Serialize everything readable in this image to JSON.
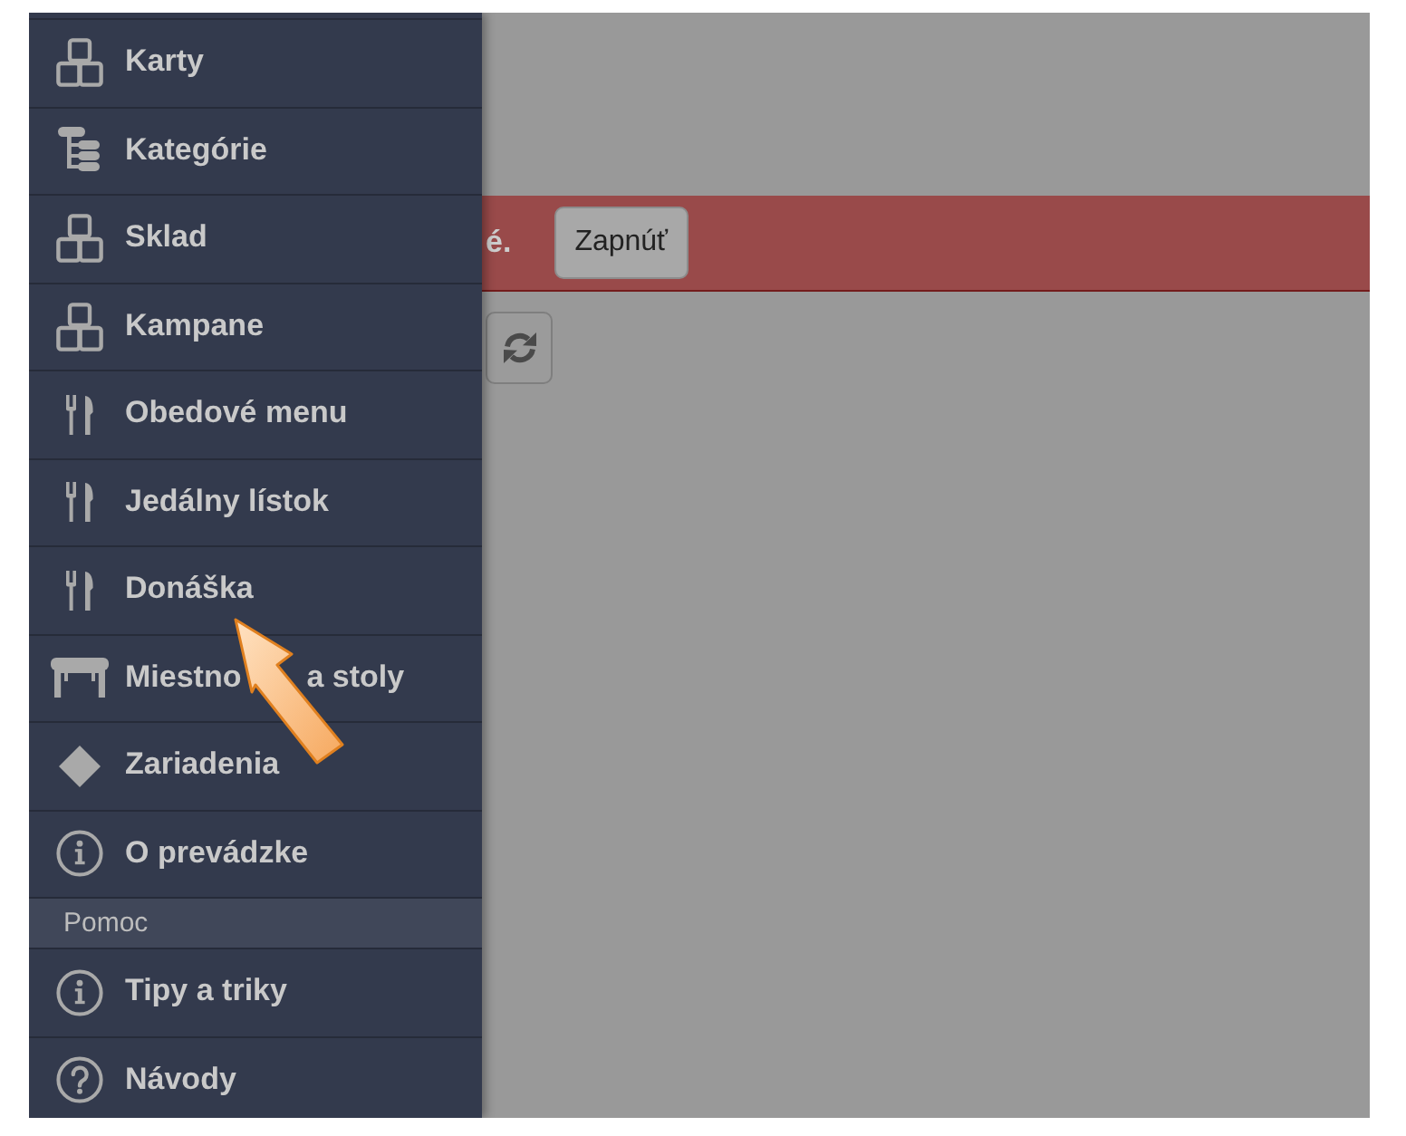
{
  "sidebar": {
    "sections": [
      {
        "items": [
          {
            "label": "Karty"
          },
          {
            "label": "Kategórie"
          },
          {
            "label": "Sklad"
          },
          {
            "label": "Kampane"
          },
          {
            "label": "Obedové menu"
          },
          {
            "label": "Jedálny lístok"
          },
          {
            "label": "Donáška"
          },
          {
            "label_parts": [
              "Miestno",
              "a stoly"
            ]
          },
          {
            "label": "Zariadenia"
          },
          {
            "label": "O prevádzke"
          }
        ]
      },
      {
        "header": "Pomoc",
        "items": [
          {
            "label": "Tipy a triky"
          },
          {
            "label": "Návody"
          }
        ]
      }
    ]
  },
  "alert": {
    "text": "é.",
    "button": "Zapnúť"
  }
}
